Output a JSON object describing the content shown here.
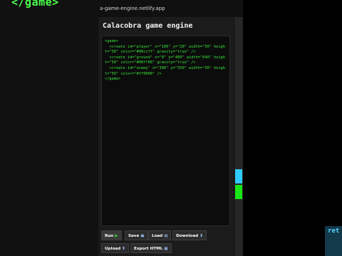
{
  "background": {
    "left_code": "</game>",
    "right_corner_text": "ret"
  },
  "browser": {
    "url": "a-game-engine.netlify.app"
  },
  "app": {
    "title": "Calacobra game engine"
  },
  "editor": {
    "code": "<game>\n  <create id=\"player\" x=\"100\" y=\"20\" width=\"50\" height=\"50\" color=\"#00ccff\" gravity=\"true\" />\n  <create id=\"ground\" x=\"0\" y=\"400\" width=\"640\" height=\"50\" color=\"#00ff00\" gravity=\"true\" />\n  <create id=\"enemy\" x=\"300\" y=\"350\" width=\"50\" height=\"50\" color=\"#ff0000\" />\n</game>"
  },
  "toolbar": {
    "run_label": "Run",
    "save_label": "Save",
    "load_label": "Load",
    "download_label": "Download",
    "upload_label": "Upload",
    "export_label": "Export HTML"
  },
  "colors": {
    "code_text": "#38e838",
    "scroll_marker_blue": "#2ecbff",
    "scroll_marker_green": "#19e619"
  }
}
